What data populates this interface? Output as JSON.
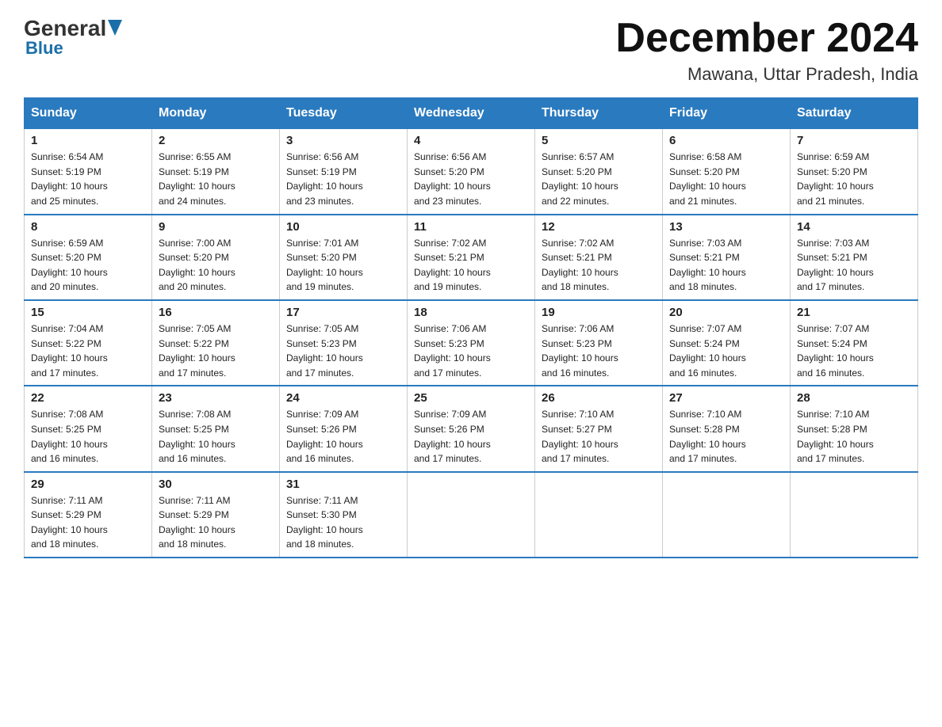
{
  "logo": {
    "general": "General",
    "blue": "Blue"
  },
  "title": "December 2024",
  "location": "Mawana, Uttar Pradesh, India",
  "days_of_week": [
    "Sunday",
    "Monday",
    "Tuesday",
    "Wednesday",
    "Thursday",
    "Friday",
    "Saturday"
  ],
  "weeks": [
    [
      {
        "day": "1",
        "sunrise": "6:54 AM",
        "sunset": "5:19 PM",
        "daylight": "10 hours and 25 minutes."
      },
      {
        "day": "2",
        "sunrise": "6:55 AM",
        "sunset": "5:19 PM",
        "daylight": "10 hours and 24 minutes."
      },
      {
        "day": "3",
        "sunrise": "6:56 AM",
        "sunset": "5:19 PM",
        "daylight": "10 hours and 23 minutes."
      },
      {
        "day": "4",
        "sunrise": "6:56 AM",
        "sunset": "5:20 PM",
        "daylight": "10 hours and 23 minutes."
      },
      {
        "day": "5",
        "sunrise": "6:57 AM",
        "sunset": "5:20 PM",
        "daylight": "10 hours and 22 minutes."
      },
      {
        "day": "6",
        "sunrise": "6:58 AM",
        "sunset": "5:20 PM",
        "daylight": "10 hours and 21 minutes."
      },
      {
        "day": "7",
        "sunrise": "6:59 AM",
        "sunset": "5:20 PM",
        "daylight": "10 hours and 21 minutes."
      }
    ],
    [
      {
        "day": "8",
        "sunrise": "6:59 AM",
        "sunset": "5:20 PM",
        "daylight": "10 hours and 20 minutes."
      },
      {
        "day": "9",
        "sunrise": "7:00 AM",
        "sunset": "5:20 PM",
        "daylight": "10 hours and 20 minutes."
      },
      {
        "day": "10",
        "sunrise": "7:01 AM",
        "sunset": "5:20 PM",
        "daylight": "10 hours and 19 minutes."
      },
      {
        "day": "11",
        "sunrise": "7:02 AM",
        "sunset": "5:21 PM",
        "daylight": "10 hours and 19 minutes."
      },
      {
        "day": "12",
        "sunrise": "7:02 AM",
        "sunset": "5:21 PM",
        "daylight": "10 hours and 18 minutes."
      },
      {
        "day": "13",
        "sunrise": "7:03 AM",
        "sunset": "5:21 PM",
        "daylight": "10 hours and 18 minutes."
      },
      {
        "day": "14",
        "sunrise": "7:03 AM",
        "sunset": "5:21 PM",
        "daylight": "10 hours and 17 minutes."
      }
    ],
    [
      {
        "day": "15",
        "sunrise": "7:04 AM",
        "sunset": "5:22 PM",
        "daylight": "10 hours and 17 minutes."
      },
      {
        "day": "16",
        "sunrise": "7:05 AM",
        "sunset": "5:22 PM",
        "daylight": "10 hours and 17 minutes."
      },
      {
        "day": "17",
        "sunrise": "7:05 AM",
        "sunset": "5:23 PM",
        "daylight": "10 hours and 17 minutes."
      },
      {
        "day": "18",
        "sunrise": "7:06 AM",
        "sunset": "5:23 PM",
        "daylight": "10 hours and 17 minutes."
      },
      {
        "day": "19",
        "sunrise": "7:06 AM",
        "sunset": "5:23 PM",
        "daylight": "10 hours and 16 minutes."
      },
      {
        "day": "20",
        "sunrise": "7:07 AM",
        "sunset": "5:24 PM",
        "daylight": "10 hours and 16 minutes."
      },
      {
        "day": "21",
        "sunrise": "7:07 AM",
        "sunset": "5:24 PM",
        "daylight": "10 hours and 16 minutes."
      }
    ],
    [
      {
        "day": "22",
        "sunrise": "7:08 AM",
        "sunset": "5:25 PM",
        "daylight": "10 hours and 16 minutes."
      },
      {
        "day": "23",
        "sunrise": "7:08 AM",
        "sunset": "5:25 PM",
        "daylight": "10 hours and 16 minutes."
      },
      {
        "day": "24",
        "sunrise": "7:09 AM",
        "sunset": "5:26 PM",
        "daylight": "10 hours and 16 minutes."
      },
      {
        "day": "25",
        "sunrise": "7:09 AM",
        "sunset": "5:26 PM",
        "daylight": "10 hours and 17 minutes."
      },
      {
        "day": "26",
        "sunrise": "7:10 AM",
        "sunset": "5:27 PM",
        "daylight": "10 hours and 17 minutes."
      },
      {
        "day": "27",
        "sunrise": "7:10 AM",
        "sunset": "5:28 PM",
        "daylight": "10 hours and 17 minutes."
      },
      {
        "day": "28",
        "sunrise": "7:10 AM",
        "sunset": "5:28 PM",
        "daylight": "10 hours and 17 minutes."
      }
    ],
    [
      {
        "day": "29",
        "sunrise": "7:11 AM",
        "sunset": "5:29 PM",
        "daylight": "10 hours and 18 minutes."
      },
      {
        "day": "30",
        "sunrise": "7:11 AM",
        "sunset": "5:29 PM",
        "daylight": "10 hours and 18 minutes."
      },
      {
        "day": "31",
        "sunrise": "7:11 AM",
        "sunset": "5:30 PM",
        "daylight": "10 hours and 18 minutes."
      },
      null,
      null,
      null,
      null
    ]
  ],
  "labels": {
    "sunrise": "Sunrise:",
    "sunset": "Sunset:",
    "daylight": "Daylight:"
  }
}
